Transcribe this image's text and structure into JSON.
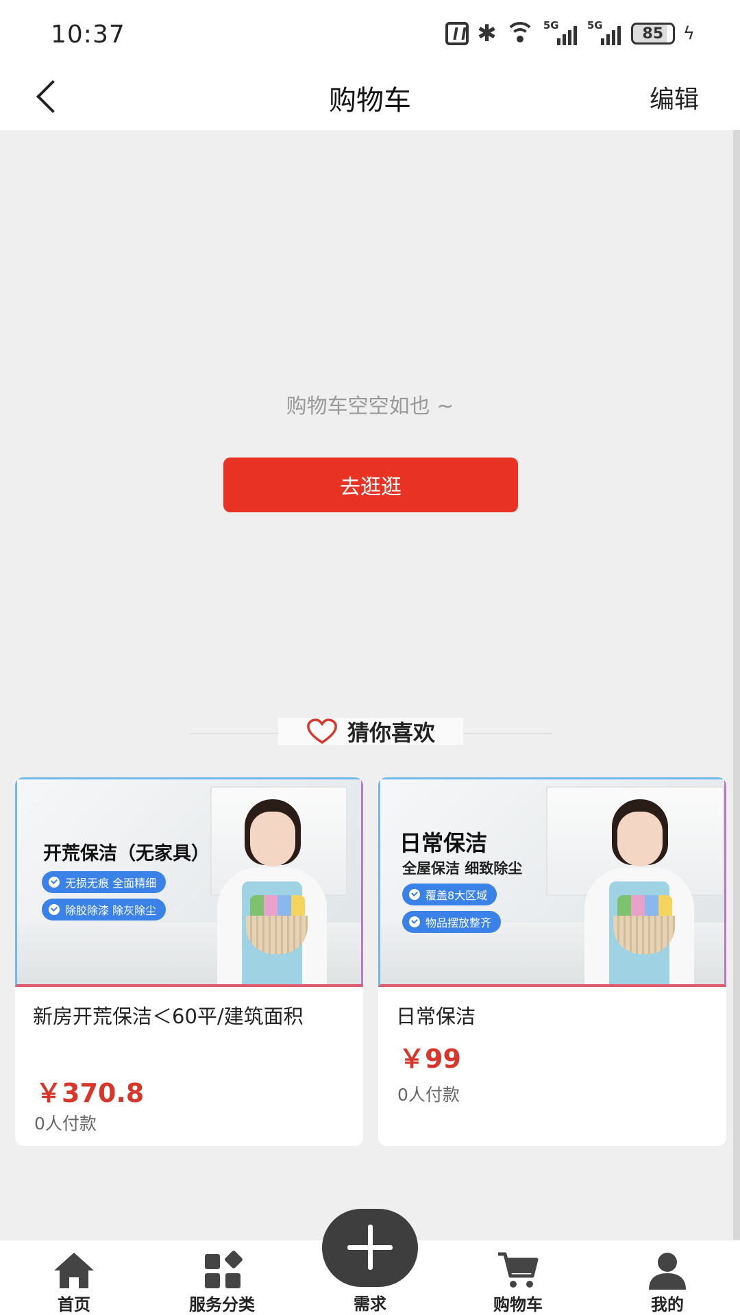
{
  "status_bar": {
    "time": "10:37",
    "signal_label_1": "5G",
    "signal_label_2": "5G",
    "battery": "85"
  },
  "header": {
    "title": "购物车",
    "edit_label": "编辑"
  },
  "empty_state": {
    "message": "购物车空空如也 ~",
    "button_label": "去逛逛"
  },
  "recommend": {
    "heading": "猜你喜欢",
    "products": [
      {
        "banner_title": "开荒保洁（无家具）",
        "banner_tags": [
          "无损无痕 全面精细",
          "除胶除漆 除灰除尘"
        ],
        "name": "新房开荒保洁＜60平/建筑面积",
        "price": "￥370.8",
        "sales": "0人付款"
      },
      {
        "banner_title": "日常保洁",
        "banner_subtitle": "全屋保洁 细致除尘",
        "banner_tags": [
          "覆盖8大区域",
          "物品摆放整齐"
        ],
        "name": "日常保洁",
        "price": "￥99",
        "sales": "0人付款"
      }
    ]
  },
  "tab_bar": {
    "items": [
      {
        "label": "首页",
        "icon": "home-icon"
      },
      {
        "label": "服务分类",
        "icon": "category-icon"
      },
      {
        "label": "需求",
        "icon": "plus-icon"
      },
      {
        "label": "购物车",
        "icon": "cart-icon"
      },
      {
        "label": "我的",
        "icon": "user-icon"
      }
    ]
  },
  "colors": {
    "accent_red": "#e83324",
    "price_red": "#d8362a",
    "tag_blue": "#3b82e8"
  }
}
